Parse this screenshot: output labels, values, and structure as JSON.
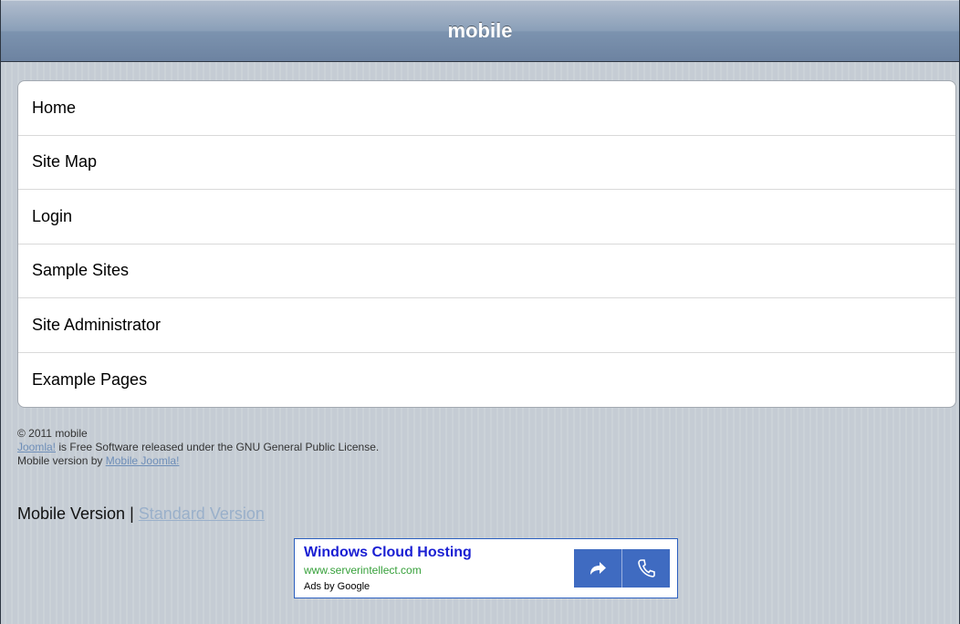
{
  "header": {
    "title": "mobile"
  },
  "menu": {
    "items": [
      {
        "label": "Home"
      },
      {
        "label": "Site Map"
      },
      {
        "label": "Login"
      },
      {
        "label": "Sample Sites"
      },
      {
        "label": "Site Administrator"
      },
      {
        "label": "Example Pages"
      }
    ]
  },
  "footer": {
    "copyright": "© 2011 mobile",
    "joomla_link": "Joomla!",
    "license_text": " is Free Software released under the GNU General Public License.",
    "mobile_by_text": "Mobile version by ",
    "mobile_joomla_link": "Mobile Joomla!"
  },
  "versions": {
    "mobile_label": "Mobile Version",
    "separator": " | ",
    "standard_link": "Standard Version"
  },
  "ad": {
    "title": "Windows Cloud Hosting",
    "url": "www.serverintellect.com",
    "by": "Ads by Google",
    "buttons": [
      "arrow-icon",
      "phone-icon"
    ]
  },
  "colors": {
    "background": "#c5ccd4",
    "header_gradient_top": "#b0bccd",
    "header_gradient_bottom": "#6d83a1",
    "link": "#6e8eb8",
    "ad_title": "#1a1fd3",
    "ad_url": "#36a03a",
    "ad_buttons": "#3f6bc1"
  }
}
